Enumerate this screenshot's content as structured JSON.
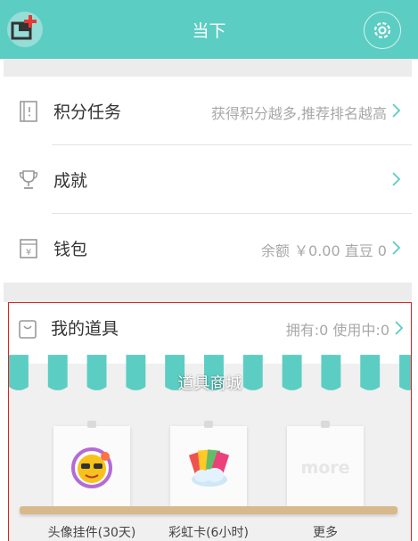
{
  "header": {
    "title": "当下",
    "accent_color": "#5ccdc2",
    "left_icon": "add-window-icon",
    "right_icon": "settings-icon"
  },
  "rows": [
    {
      "label": "积分任务",
      "value": "获得积分越多,推荐排名越高",
      "icon": "task-book-icon"
    },
    {
      "label": "成就",
      "value": "",
      "icon": "trophy-icon"
    },
    {
      "label": "钱包",
      "value": "余额 ￥0.00  直豆 0",
      "icon": "wallet-icon"
    }
  ],
  "props": {
    "label": "我的道具",
    "value": "拥有:0  使用中:0",
    "icon": "bag-icon"
  },
  "shop": {
    "title": "道具商城",
    "items": [
      {
        "label": "头像挂件(30天)",
        "icon": "avatar-pendant-icon"
      },
      {
        "label": "彩虹卡(6小时)",
        "icon": "rainbow-card-icon"
      },
      {
        "label": "更多",
        "card_text": "more"
      }
    ]
  },
  "highlight_color": "#e02020"
}
